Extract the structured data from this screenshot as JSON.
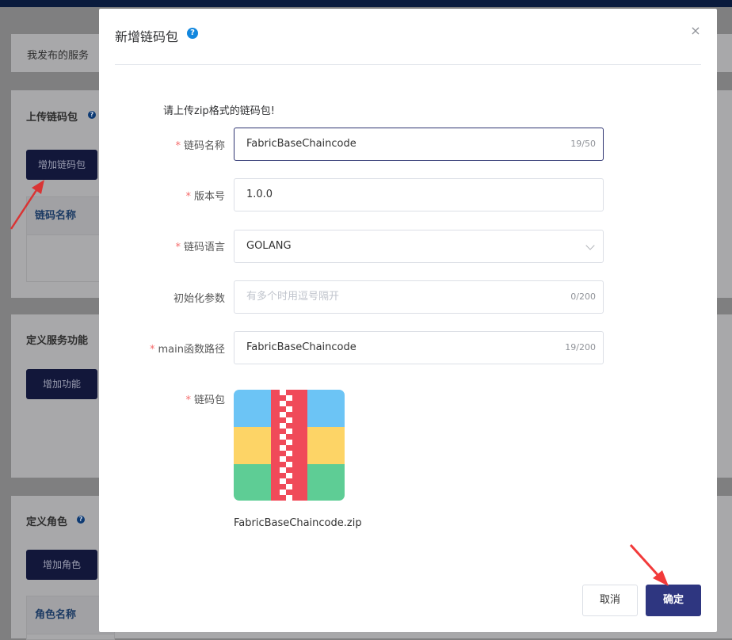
{
  "background": {
    "my_services_tab": "我发布的服务",
    "upload_section": {
      "title": "上传链码包",
      "add_button": "增加链码包",
      "table_header_name": "链码名称"
    },
    "function_section": {
      "title": "定义服务功能",
      "add_button": "增加功能"
    },
    "role_section": {
      "title": "定义角色",
      "add_button": "增加角色",
      "table_header_name": "角色名称"
    }
  },
  "modal": {
    "title": "新增链码包",
    "help_glyph": "?",
    "close_glyph": "×",
    "hint": "请上传zip格式的链码包!",
    "fields": {
      "name": {
        "label": "链码名称",
        "required": true,
        "value": "FabricBaseChaincode",
        "counter": "19/50"
      },
      "version": {
        "label": "版本号",
        "required": true,
        "value": "1.0.0"
      },
      "language": {
        "label": "链码语言",
        "required": true,
        "value": "GOLANG"
      },
      "init_params": {
        "label": "初始化参数",
        "required": false,
        "placeholder": "有多个时用逗号隔开",
        "counter": "0/200"
      },
      "main_path": {
        "label": "main函数路径",
        "required": true,
        "value": "FabricBaseChaincode",
        "counter": "19/200"
      },
      "package": {
        "label": "链码包",
        "required": true,
        "file_name": "FabricBaseChaincode.zip",
        "icon": "zip-archive-icon"
      }
    },
    "required_mark": "*",
    "cancel_button": "取消",
    "ok_button": "确定"
  },
  "colors": {
    "primary": "#2e3680",
    "required": "#f56c6c",
    "help": "#1287de",
    "annotation_arrow": "#f23a3a"
  }
}
